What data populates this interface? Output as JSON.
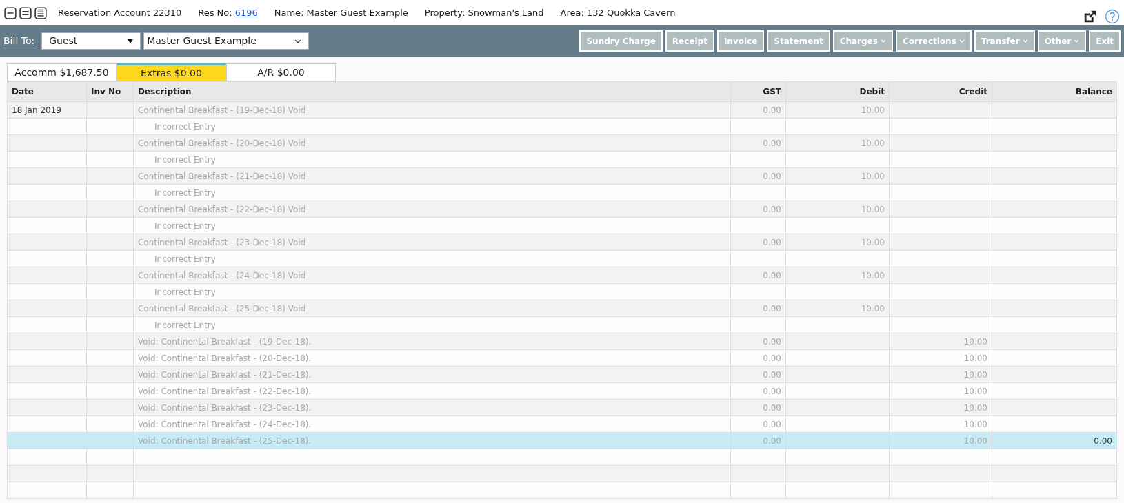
{
  "header": {
    "title": "Reservation Account 22310",
    "res_no_label": "Res No:",
    "res_no": "6196",
    "name": "Name: Master Guest Example",
    "property": "Property: Snowman's Land",
    "area": "Area: 132 Quokka Cavern"
  },
  "toolbar": {
    "bill_to_label": "Bill To:",
    "bill_to": "Guest",
    "guest": "Master Guest Example",
    "buttons": [
      {
        "label": "Sundry Charge",
        "dropdown": false
      },
      {
        "label": "Receipt",
        "dropdown": false
      },
      {
        "label": "Invoice",
        "dropdown": false
      },
      {
        "label": "Statement",
        "dropdown": false
      },
      {
        "label": "Charges",
        "dropdown": true
      },
      {
        "label": "Corrections",
        "dropdown": true
      },
      {
        "label": "Transfer",
        "dropdown": true
      },
      {
        "label": "Other",
        "dropdown": true
      },
      {
        "label": "Exit",
        "dropdown": false
      }
    ]
  },
  "tabs": [
    {
      "label": "Accomm $1,687.50",
      "selected": false
    },
    {
      "label": "Extras $0.00",
      "selected": true
    },
    {
      "label": "A/R $0.00",
      "selected": false
    }
  ],
  "table": {
    "columns": [
      "Date",
      "Inv No",
      "Description",
      "GST",
      "Debit",
      "Credit",
      "Balance"
    ],
    "rows": [
      {
        "kind": "charge",
        "selected": false,
        "date": "18 Jan 2019",
        "description": "Continental Breakfast - (19-Dec-18) Void",
        "gst": "0.00",
        "debit": "10.00"
      },
      {
        "kind": "note",
        "selected": false,
        "description": "Incorrect Entry"
      },
      {
        "kind": "charge",
        "selected": false,
        "description": "Continental Breakfast - (20-Dec-18) Void",
        "gst": "0.00",
        "debit": "10.00"
      },
      {
        "kind": "note",
        "selected": false,
        "description": "Incorrect Entry"
      },
      {
        "kind": "charge",
        "selected": false,
        "description": "Continental Breakfast - (21-Dec-18) Void",
        "gst": "0.00",
        "debit": "10.00"
      },
      {
        "kind": "note",
        "selected": false,
        "description": "Incorrect Entry"
      },
      {
        "kind": "charge",
        "selected": false,
        "description": "Continental Breakfast - (22-Dec-18) Void",
        "gst": "0.00",
        "debit": "10.00"
      },
      {
        "kind": "note",
        "selected": false,
        "description": "Incorrect Entry"
      },
      {
        "kind": "charge",
        "selected": false,
        "description": "Continental Breakfast - (23-Dec-18) Void",
        "gst": "0.00",
        "debit": "10.00"
      },
      {
        "kind": "note",
        "selected": false,
        "description": "Incorrect Entry"
      },
      {
        "kind": "charge",
        "selected": false,
        "description": "Continental Breakfast - (24-Dec-18) Void",
        "gst": "0.00",
        "debit": "10.00"
      },
      {
        "kind": "note",
        "selected": false,
        "description": "Incorrect Entry"
      },
      {
        "kind": "charge",
        "selected": false,
        "description": "Continental Breakfast - (25-Dec-18) Void",
        "gst": "0.00",
        "debit": "10.00"
      },
      {
        "kind": "note",
        "selected": false,
        "description": "Incorrect Entry"
      },
      {
        "kind": "charge",
        "selected": false,
        "description": "Void: Continental Breakfast - (19-Dec-18).",
        "gst": "0.00",
        "credit": "10.00"
      },
      {
        "kind": "charge",
        "selected": false,
        "description": "Void: Continental Breakfast - (20-Dec-18).",
        "gst": "0.00",
        "credit": "10.00"
      },
      {
        "kind": "charge",
        "selected": false,
        "description": "Void: Continental Breakfast - (21-Dec-18).",
        "gst": "0.00",
        "credit": "10.00"
      },
      {
        "kind": "charge",
        "selected": false,
        "description": "Void: Continental Breakfast - (22-Dec-18).",
        "gst": "0.00",
        "credit": "10.00"
      },
      {
        "kind": "charge",
        "selected": false,
        "description": "Void: Continental Breakfast - (23-Dec-18).",
        "gst": "0.00",
        "credit": "10.00"
      },
      {
        "kind": "charge",
        "selected": false,
        "description": "Void: Continental Breakfast - (24-Dec-18).",
        "gst": "0.00",
        "credit": "10.00"
      },
      {
        "kind": "charge",
        "selected": true,
        "description": "Void: Continental Breakfast - (25-Dec-18).",
        "gst": "0.00",
        "credit": "10.00",
        "balance": "0.00"
      }
    ]
  }
}
